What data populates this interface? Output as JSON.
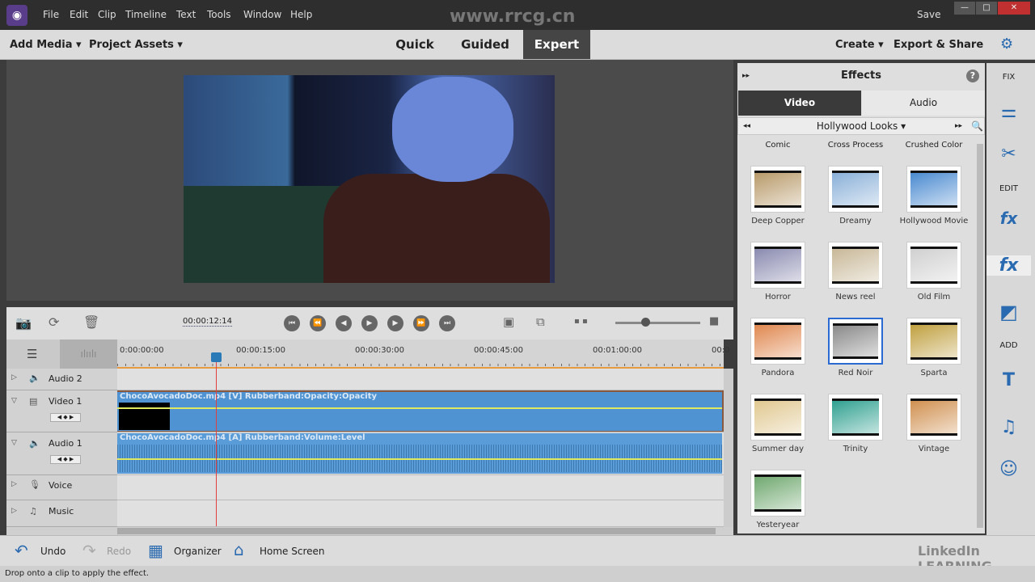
{
  "menu": [
    "File",
    "Edit",
    "Clip",
    "Timeline",
    "Text",
    "Tools",
    "Window",
    "Help"
  ],
  "save_label": "Save",
  "watermark": "www.rrcg.cn",
  "toolbar": {
    "add_media": "Add Media",
    "project_assets": "Project Assets",
    "modes": [
      "Quick",
      "Guided",
      "Expert"
    ],
    "active_mode": "Expert",
    "create": "Create",
    "export_share": "Export & Share"
  },
  "timeline": {
    "current_time": "00:00:12:14",
    "ruler": [
      "0:00:00:00",
      "00:00:15:00",
      "00:00:30:00",
      "00:00:45:00",
      "00:01:00:00",
      "00:0"
    ],
    "tracks": [
      {
        "name": "Audio 2",
        "icon": "speaker-icon"
      },
      {
        "name": "Video 1",
        "icon": "film-icon"
      },
      {
        "name": "Audio 1",
        "icon": "speaker-icon"
      },
      {
        "name": "Voice",
        "icon": "microphone-icon"
      },
      {
        "name": "Music",
        "icon": "music-note-icon"
      }
    ],
    "video_clip": "ChocoAvocadoDoc.mp4 [V] Rubberband:Opacity:Opacity",
    "audio_clip": "ChocoAvocadoDoc.mp4 [A] Rubberband:Volume:Level"
  },
  "effects": {
    "title": "Effects",
    "tabs": [
      "Video",
      "Audio"
    ],
    "active_tab": "Video",
    "category": "Hollywood Looks",
    "top_row": [
      "Comic",
      "Cross Process",
      "Crushed Color"
    ],
    "items": [
      {
        "name": "Deep Copper",
        "color": "#b89a6a"
      },
      {
        "name": "Dreamy",
        "color": "#8ab0d8"
      },
      {
        "name": "Hollywood Movie",
        "color": "#4a8ad0"
      },
      {
        "name": "Horror",
        "color": "#8a8ab0"
      },
      {
        "name": "News reel",
        "color": "#c8b898"
      },
      {
        "name": "Old Film",
        "color": "#d0d0d0"
      },
      {
        "name": "Pandora",
        "color": "#e08850"
      },
      {
        "name": "Red Noir",
        "color": "#8a8a8a"
      },
      {
        "name": "Sparta",
        "color": "#c0a040"
      },
      {
        "name": "Summer day",
        "color": "#e0c890"
      },
      {
        "name": "Trinity",
        "color": "#30a090"
      },
      {
        "name": "Vintage",
        "color": "#d09050"
      },
      {
        "name": "Yesteryear",
        "color": "#70a870"
      }
    ],
    "selected": "Red Noir"
  },
  "sidebar": {
    "fix": "FIX",
    "edit": "EDIT",
    "add": "ADD"
  },
  "bottom": {
    "undo": "Undo",
    "redo": "Redo",
    "organizer": "Organizer",
    "home": "Home Screen",
    "brand": "LinkedIn LEARNING"
  },
  "status": "Drop onto a clip to apply the effect."
}
